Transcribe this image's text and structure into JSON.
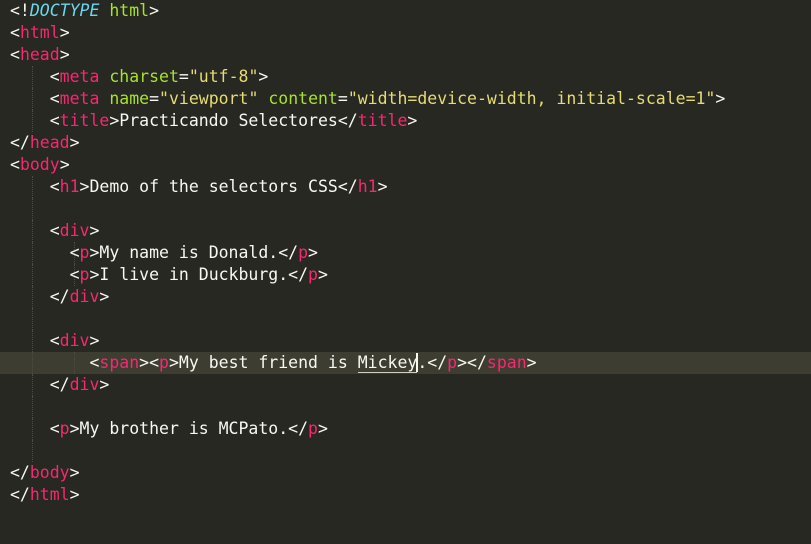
{
  "editor": {
    "theme_colors": {
      "background": "#272822",
      "active_line": "#3e3d32",
      "tag": "#f92672",
      "attribute": "#a6e22e",
      "string": "#e6db74",
      "doctype": "#66d9ef",
      "text": "#f8f8f2"
    },
    "cursor": {
      "line": 17,
      "after_text": "Mickey"
    },
    "lines": [
      [
        [
          "pun",
          "<!"
        ],
        [
          "doc",
          "DOCTYPE"
        ],
        [
          "pun",
          " "
        ],
        [
          "attr",
          "html"
        ],
        [
          "pun",
          ">"
        ]
      ],
      [
        [
          "pun",
          "<"
        ],
        [
          "tag",
          "html"
        ],
        [
          "pun",
          ">"
        ]
      ],
      [
        [
          "pun",
          "<"
        ],
        [
          "tag",
          "head"
        ],
        [
          "pun",
          ">"
        ]
      ],
      [
        [
          "pun",
          "    <"
        ],
        [
          "tag",
          "meta"
        ],
        [
          "pun",
          " "
        ],
        [
          "attr",
          "charset"
        ],
        [
          "pun",
          "="
        ],
        [
          "str",
          "\"utf-8\""
        ],
        [
          "pun",
          ">"
        ]
      ],
      [
        [
          "pun",
          "    <"
        ],
        [
          "tag",
          "meta"
        ],
        [
          "pun",
          " "
        ],
        [
          "attr",
          "name"
        ],
        [
          "pun",
          "="
        ],
        [
          "str",
          "\"viewport\""
        ],
        [
          "pun",
          " "
        ],
        [
          "attr",
          "content"
        ],
        [
          "pun",
          "="
        ],
        [
          "str",
          "\"width=device-width, initial-scale=1\""
        ],
        [
          "pun",
          ">"
        ]
      ],
      [
        [
          "pun",
          "    <"
        ],
        [
          "tag",
          "title"
        ],
        [
          "pun",
          ">"
        ],
        [
          "txt",
          "Practicando Selectores"
        ],
        [
          "pun",
          "</"
        ],
        [
          "tag",
          "title"
        ],
        [
          "pun",
          ">"
        ]
      ],
      [
        [
          "pun",
          "</"
        ],
        [
          "tag",
          "head"
        ],
        [
          "pun",
          ">"
        ]
      ],
      [
        [
          "pun",
          "<"
        ],
        [
          "tag",
          "body"
        ],
        [
          "pun",
          ">"
        ]
      ],
      [
        [
          "pun",
          "    <"
        ],
        [
          "tag",
          "h1"
        ],
        [
          "pun",
          ">"
        ],
        [
          "txt",
          "Demo of the selectors CSS"
        ],
        [
          "pun",
          "</"
        ],
        [
          "tag",
          "h1"
        ],
        [
          "pun",
          ">"
        ]
      ],
      [],
      [
        [
          "pun",
          "    <"
        ],
        [
          "tag",
          "div"
        ],
        [
          "pun",
          ">"
        ]
      ],
      [
        [
          "pun",
          "      <"
        ],
        [
          "tag",
          "p"
        ],
        [
          "pun",
          ">"
        ],
        [
          "txt",
          "My name is Donald."
        ],
        [
          "pun",
          "</"
        ],
        [
          "tag",
          "p"
        ],
        [
          "pun",
          ">"
        ]
      ],
      [
        [
          "pun",
          "      <"
        ],
        [
          "tag",
          "p"
        ],
        [
          "pun",
          ">"
        ],
        [
          "txt",
          "I live in Duckburg."
        ],
        [
          "pun",
          "</"
        ],
        [
          "tag",
          "p"
        ],
        [
          "pun",
          ">"
        ]
      ],
      [
        [
          "pun",
          "    </"
        ],
        [
          "tag",
          "div"
        ],
        [
          "pun",
          ">"
        ]
      ],
      [],
      [
        [
          "pun",
          "    <"
        ],
        [
          "tag",
          "div"
        ],
        [
          "pun",
          ">"
        ]
      ],
      [
        [
          "pun",
          "        <"
        ],
        [
          "tag",
          "span"
        ],
        [
          "pun",
          "><"
        ],
        [
          "tag",
          "p"
        ],
        [
          "pun",
          ">"
        ],
        [
          "txt",
          "My best friend is "
        ],
        [
          "hl",
          "Mickey"
        ],
        [
          "cursor",
          ""
        ],
        [
          "txt",
          "."
        ],
        [
          "pun",
          "</"
        ],
        [
          "tag",
          "p"
        ],
        [
          "pun",
          "></"
        ],
        [
          "tag",
          "span"
        ],
        [
          "pun",
          ">"
        ]
      ],
      [
        [
          "pun",
          "    </"
        ],
        [
          "tag",
          "div"
        ],
        [
          "pun",
          ">"
        ]
      ],
      [],
      [
        [
          "pun",
          "    <"
        ],
        [
          "tag",
          "p"
        ],
        [
          "pun",
          ">"
        ],
        [
          "txt",
          "My brother is MCPato."
        ],
        [
          "pun",
          "</"
        ],
        [
          "tag",
          "p"
        ],
        [
          "pun",
          ">"
        ]
      ],
      [],
      [
        [
          "pun",
          "</"
        ],
        [
          "tag",
          "body"
        ],
        [
          "pun",
          ">"
        ]
      ],
      [
        [
          "pun",
          "</"
        ],
        [
          "tag",
          "html"
        ],
        [
          "pun",
          ">"
        ]
      ]
    ]
  }
}
